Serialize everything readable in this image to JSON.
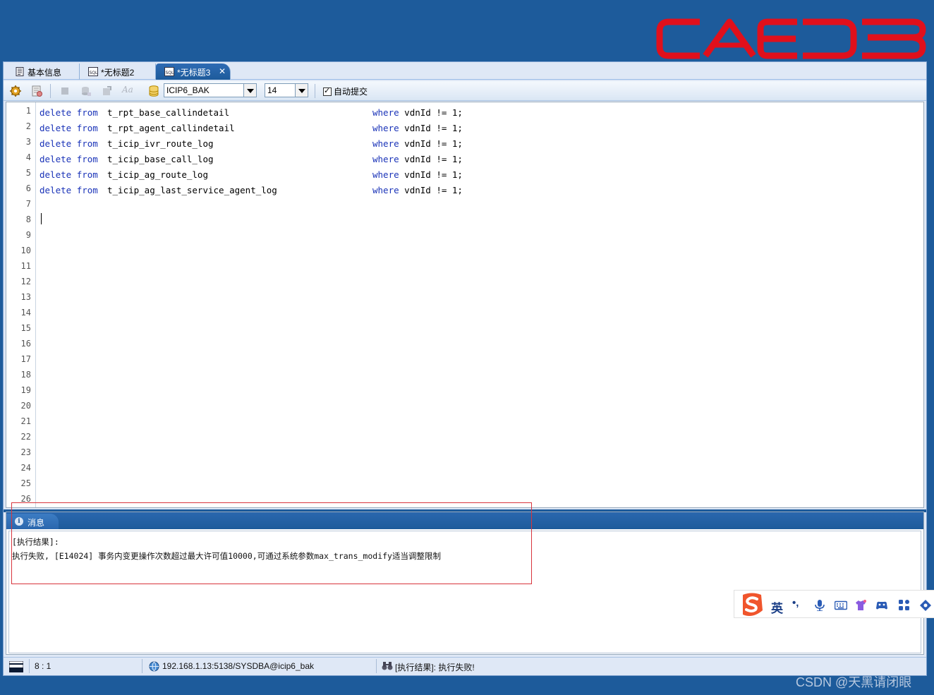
{
  "logo": {
    "text": "CAEDB",
    "color": "#e0101c"
  },
  "tabs": [
    {
      "label": "基本信息",
      "icon": "document-icon",
      "active": false
    },
    {
      "label": "*无标题2",
      "icon": "sql-file-icon",
      "active": false
    },
    {
      "label": "*无标题3",
      "icon": "sql-file-icon",
      "active": true,
      "close": "✕"
    }
  ],
  "toolbar": {
    "schema_select": "ICIP6_BAK",
    "font_size_select": "14",
    "autocommit_label": "自动提交",
    "autocommit_checked": true,
    "format_label": "Aa"
  },
  "editor": {
    "line_numbers": [
      "1",
      "2",
      "3",
      "4",
      "5",
      "6",
      "7",
      "8",
      "9",
      "10",
      "11",
      "12",
      "13",
      "14",
      "15",
      "16",
      "17",
      "18",
      "19",
      "20",
      "21",
      "22",
      "23",
      "24",
      "25",
      "26"
    ],
    "lines": [
      {
        "kw1": "delete",
        "kw2": "from",
        "table": "t_rpt_base_callindetail",
        "kw3": "where",
        "cond": " vdnId != 1;"
      },
      {
        "kw1": "delete",
        "kw2": "from",
        "table": "t_rpt_agent_callindetail",
        "kw3": "where",
        "cond": " vdnId != 1;"
      },
      {
        "kw1": "delete",
        "kw2": "from",
        "table": "t_icip_ivr_route_log",
        "kw3": "where",
        "cond": " vdnId != 1;"
      },
      {
        "kw1": "delete",
        "kw2": "from",
        "table": "t_icip_base_call_log",
        "kw3": "where",
        "cond": " vdnId != 1;"
      },
      {
        "kw1": "delete",
        "kw2": "from",
        "table": "t_icip_ag_route_log",
        "kw3": "where",
        "cond": " vdnId != 1;"
      },
      {
        "kw1": "delete",
        "kw2": "from",
        "table": "t_icip_ag_last_service_agent_log",
        "kw3": "where",
        "cond": " vdnId != 1;"
      }
    ]
  },
  "messages": {
    "tab_label": "消息",
    "lines": [
      "[执行结果]:",
      "执行失败, [E14024] 事务内变更操作次数超过最大许可值10000,可通过系统参数max_trans_modify适当调整限制"
    ]
  },
  "status": {
    "cursor": "8 : 1",
    "connection": "192.168.1.13:5138/SYSDBA@icip6_bak",
    "result": "[执行结果]: 执行失败!"
  },
  "ime": {
    "lang": "英",
    "punct": "•,"
  },
  "watermark": "CSDN @天黑请闭眼",
  "colors": {
    "background": "#1d5b9b",
    "keyword": "#1a33b8",
    "annotation": "#d8343c"
  }
}
